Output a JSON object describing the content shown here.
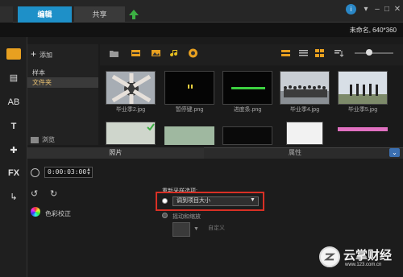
{
  "tabs": {
    "left_partial": "",
    "edit": "编辑",
    "share": "共享"
  },
  "project_info": "未命名, 640*360",
  "library": {
    "add_label": "添加",
    "items": [
      "样本",
      "文件夹"
    ],
    "browse_label": "浏览"
  },
  "media": [
    {
      "caption": "毕业季2.jpg"
    },
    {
      "caption": "暂停键.png"
    },
    {
      "caption": "进度条.png"
    },
    {
      "caption": "毕业季4.jpg"
    },
    {
      "caption": "毕业季5.jpg"
    }
  ],
  "options": {
    "tab_photo": "照片",
    "tab_attributes": "属性",
    "duration": "0:00:03:00",
    "color_correction": "色彩校正",
    "resample_label": "重新采样选项:",
    "resample_value": "调到项目大小",
    "pan_zoom": "摇动和缩放",
    "custom": "自定义"
  },
  "watermark": {
    "title": "云掌财经",
    "url": "www.123.com.cn"
  },
  "colors": {
    "accent": "#1e90c8",
    "highlight": "#d93025"
  }
}
